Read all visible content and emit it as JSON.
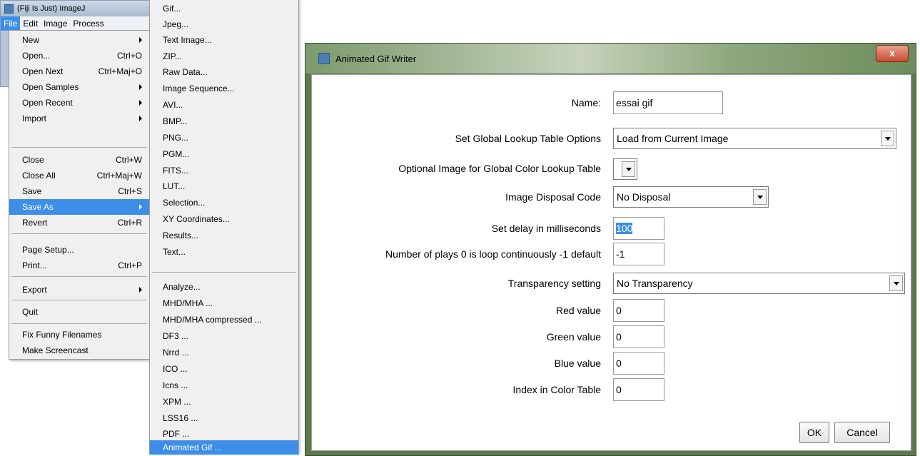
{
  "main_window": {
    "title": "(Fiji Is Just) ImageJ",
    "menus": [
      "File",
      "Edit",
      "Image",
      "Process"
    ]
  },
  "file_menu": {
    "items": [
      {
        "label": "New",
        "shortcut": "",
        "submenu": true
      },
      {
        "label": "Open...",
        "shortcut": "Ctrl+O",
        "submenu": false
      },
      {
        "label": "Open Next",
        "shortcut": "Ctrl+Maj+O",
        "submenu": false
      },
      {
        "label": "Open Samples",
        "shortcut": "",
        "submenu": true
      },
      {
        "label": "Open Recent",
        "shortcut": "",
        "submenu": true
      },
      {
        "label": "Import",
        "shortcut": "",
        "submenu": true
      },
      {
        "label": "Close",
        "shortcut": "Ctrl+W",
        "submenu": false
      },
      {
        "label": "Close All",
        "shortcut": "Ctrl+Maj+W",
        "submenu": false
      },
      {
        "label": "Save",
        "shortcut": "Ctrl+S",
        "submenu": false
      },
      {
        "label": "Save As",
        "shortcut": "",
        "submenu": true
      },
      {
        "label": "Revert",
        "shortcut": "Ctrl+R",
        "submenu": false
      },
      {
        "label": "Page Setup...",
        "shortcut": "",
        "submenu": false
      },
      {
        "label": "Print...",
        "shortcut": "Ctrl+P",
        "submenu": false
      },
      {
        "label": "Export",
        "shortcut": "",
        "submenu": true
      },
      {
        "label": "Quit",
        "shortcut": "",
        "submenu": false
      },
      {
        "label": "Fix Funny Filenames",
        "shortcut": "",
        "submenu": false
      },
      {
        "label": "Make Screencast",
        "shortcut": "",
        "submenu": false
      }
    ]
  },
  "save_as_menu": {
    "items": [
      "Gif...",
      "Jpeg...",
      "Text Image...",
      "ZIP...",
      "Raw Data...",
      "Image Sequence...",
      "AVI...",
      "BMP...",
      "PNG...",
      "PGM...",
      "FITS...",
      "LUT...",
      "Selection...",
      "XY Coordinates...",
      "Results...",
      "Text...",
      "Analyze...",
      "MHD/MHA ...",
      "MHD/MHA compressed ...",
      "DF3 ...",
      "Nrrd ...",
      "ICO ...",
      "Icns ...",
      "XPM ...",
      "LSS16 ...",
      "PDF ...",
      "Animated Gif ..."
    ]
  },
  "dialog": {
    "title": "Animated Gif Writer",
    "close_label": "x",
    "fields": {
      "name": {
        "label": "Name:",
        "value": "essai gif"
      },
      "global_lut": {
        "label": "Set Global Lookup Table Options",
        "value": "Load from Current Image"
      },
      "optional_image": {
        "label": "Optional Image for Global Color Lookup Table",
        "value": ""
      },
      "disposal": {
        "label": "Image Disposal Code",
        "value": "No Disposal"
      },
      "delay": {
        "label": "Set delay in milliseconds",
        "value": "100"
      },
      "plays": {
        "label": "Number of plays 0 is loop continuously -1 default",
        "value": "-1"
      },
      "transparency": {
        "label": "Transparency setting",
        "value": "No Transparency"
      },
      "red": {
        "label": "Red value",
        "value": "0"
      },
      "green": {
        "label": "Green value",
        "value": "0"
      },
      "blue": {
        "label": "Blue value",
        "value": "0"
      },
      "index": {
        "label": "Index in Color Table",
        "value": "0"
      }
    },
    "ok_label": "OK",
    "cancel_label": "Cancel"
  }
}
